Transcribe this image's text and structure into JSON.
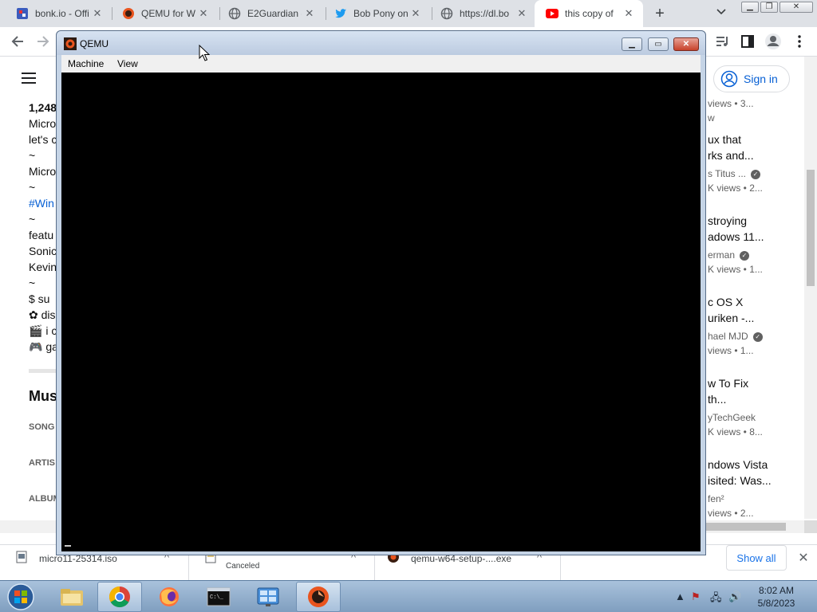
{
  "browser": {
    "tabs": [
      {
        "title": "bonk.io - Offi",
        "icon": "bonk-icon",
        "active": false
      },
      {
        "title": "QEMU for Wi",
        "icon": "qemu-icon",
        "active": false
      },
      {
        "title": "E2Guardian -",
        "icon": "globe-icon",
        "active": false
      },
      {
        "title": "Bob Pony on",
        "icon": "twitter-icon",
        "active": false
      },
      {
        "title": "https://dl.bo",
        "icon": "globe-icon",
        "active": false
      },
      {
        "title": "this copy of",
        "icon": "youtube-icon",
        "active": true
      }
    ],
    "new_tab_symbol": "+"
  },
  "youtube": {
    "sign_in_label": "Sign in",
    "description_lines": [
      "1,248",
      "Micro",
      "let's c",
      "~",
      "Micro",
      "~",
      "#Win",
      "~",
      "featu",
      "Sonic",
      "Kevin",
      "~",
      "$ su",
      "✿ dis",
      "🎬 i c",
      "🎮 ga"
    ],
    "music_heading": "Mus",
    "music_labels": [
      "SONG",
      "ARTIS",
      "ALBUM"
    ],
    "related": [
      {
        "line1": "views  •  3...",
        "line2": "w"
      },
      {
        "title1": "ux that",
        "title2": "rks and...",
        "channel": "s Titus ...",
        "meta": "K views  •  2..."
      },
      {
        "title1": "stroying",
        "title2": "adows 11...",
        "channel": "erman",
        "meta": "K views  •  1..."
      },
      {
        "title1": "c OS X",
        "title2": "uriken -...",
        "channel": "hael MJD",
        "meta": "views  •  1..."
      },
      {
        "title1": "w To Fix",
        "title2": "th...",
        "channel": "yTechGeek",
        "meta": "K views  •  8..."
      },
      {
        "title1": "ndows Vista",
        "title2": "isited: Was...",
        "channel": "fen²",
        "meta": "views  •  2..."
      }
    ]
  },
  "downloads": {
    "items": [
      {
        "file": "micro11-25314.iso",
        "status": ""
      },
      {
        "file": "",
        "status": "Canceled"
      },
      {
        "file": "qemu-w64-setup-....exe",
        "status": ""
      }
    ],
    "show_all_label": "Show all"
  },
  "qemu": {
    "title": "QEMU",
    "menu": [
      "Machine",
      "View"
    ]
  },
  "taskbar": {
    "time": "8:02 AM",
    "date": "5/8/2023",
    "apps": [
      "explorer-icon",
      "chrome-icon",
      "firefox-icon",
      "cmd-icon",
      "control-panel-icon",
      "qemu-icon"
    ]
  },
  "colors": {
    "youtube_blue": "#065fd4",
    "qemu_close": "#c7412a",
    "chrome_tabstrip": "#dee1e6"
  }
}
